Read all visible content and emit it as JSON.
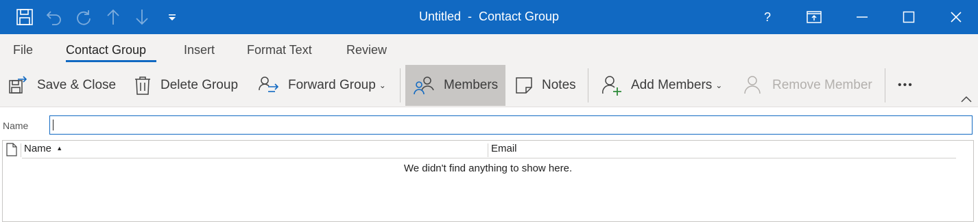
{
  "window": {
    "title": "Untitled",
    "title_sep": "-",
    "subtitle": "Contact Group",
    "help_label": "?"
  },
  "tabs": [
    {
      "label": "File"
    },
    {
      "label": "Contact Group"
    },
    {
      "label": "Insert"
    },
    {
      "label": "Format Text"
    },
    {
      "label": "Review"
    }
  ],
  "ribbon": {
    "save_close": "Save & Close",
    "delete_group": "Delete Group",
    "forward_group": "Forward Group",
    "members": "Members",
    "notes": "Notes",
    "add_members": "Add Members",
    "remove_member": "Remove Member",
    "more": "•••"
  },
  "form": {
    "name_label": "Name",
    "name_value": ""
  },
  "list": {
    "col_name": "Name",
    "col_email": "Email",
    "empty_message": "We didn't find anything to show here."
  },
  "colors": {
    "accent": "#1169c2",
    "ribbon_bg": "#f3f2f1",
    "active_button_bg": "#c8c6c4"
  }
}
